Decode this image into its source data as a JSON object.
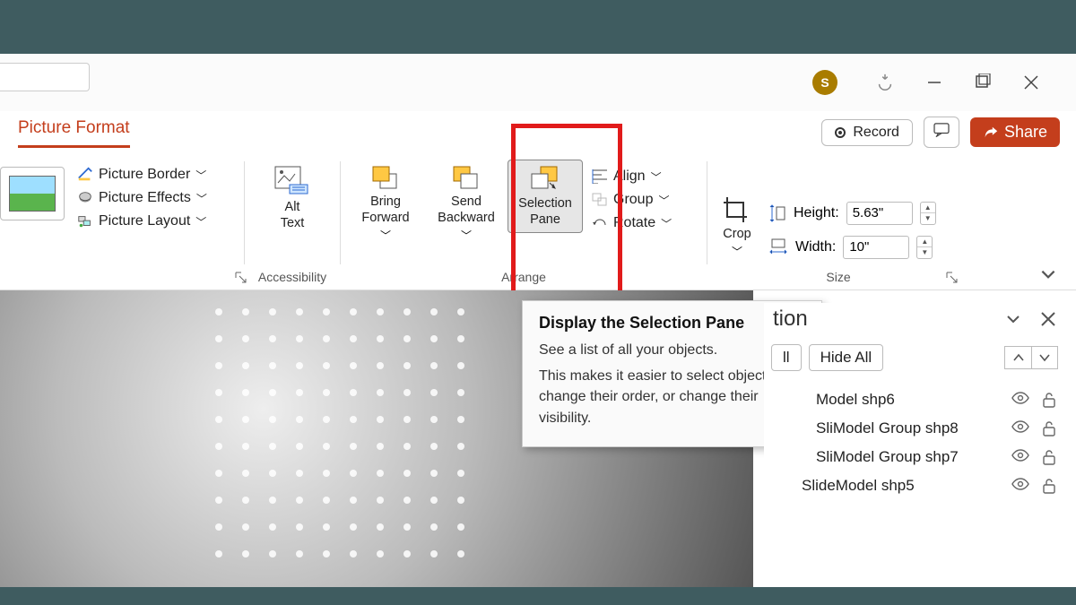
{
  "titlebar": {
    "avatar_initial": "S"
  },
  "ribbon": {
    "active_tab": "Picture Format",
    "record_label": "Record",
    "share_label": "Share",
    "groups": {
      "styles": {
        "border": "Picture Border",
        "effects": "Picture Effects",
        "layout": "Picture Layout"
      },
      "accessibility": {
        "alt_text": "Alt\nText",
        "label": "Accessibility"
      },
      "arrange": {
        "bring_forward": "Bring\nForward",
        "send_backward": "Send\nBackward",
        "selection_pane": "Selection\nPane",
        "align": "Align",
        "group": "Group",
        "rotate": "Rotate",
        "label": "Arrange"
      },
      "size": {
        "crop": "Crop",
        "height_label": "Height:",
        "height_value": "5.63\"",
        "width_label": "Width:",
        "width_value": "10\"",
        "label": "Size"
      }
    }
  },
  "tooltip": {
    "title": "Display the Selection Pane",
    "line1": "See a list of all your objects.",
    "line2": "This makes it easier to select objects, change their order, or change their visibility."
  },
  "selection_pane": {
    "title_fragment": "tion",
    "show_all_fragment": "ll",
    "hide_all": "Hide All",
    "items": [
      {
        "label": "Model shp6",
        "indent": 1
      },
      {
        "label": "SliModel Group shp8",
        "indent": 1
      },
      {
        "label": "SliModel Group shp7",
        "indent": 1
      },
      {
        "label": "SlideModel shp5",
        "indent": 0
      }
    ]
  }
}
